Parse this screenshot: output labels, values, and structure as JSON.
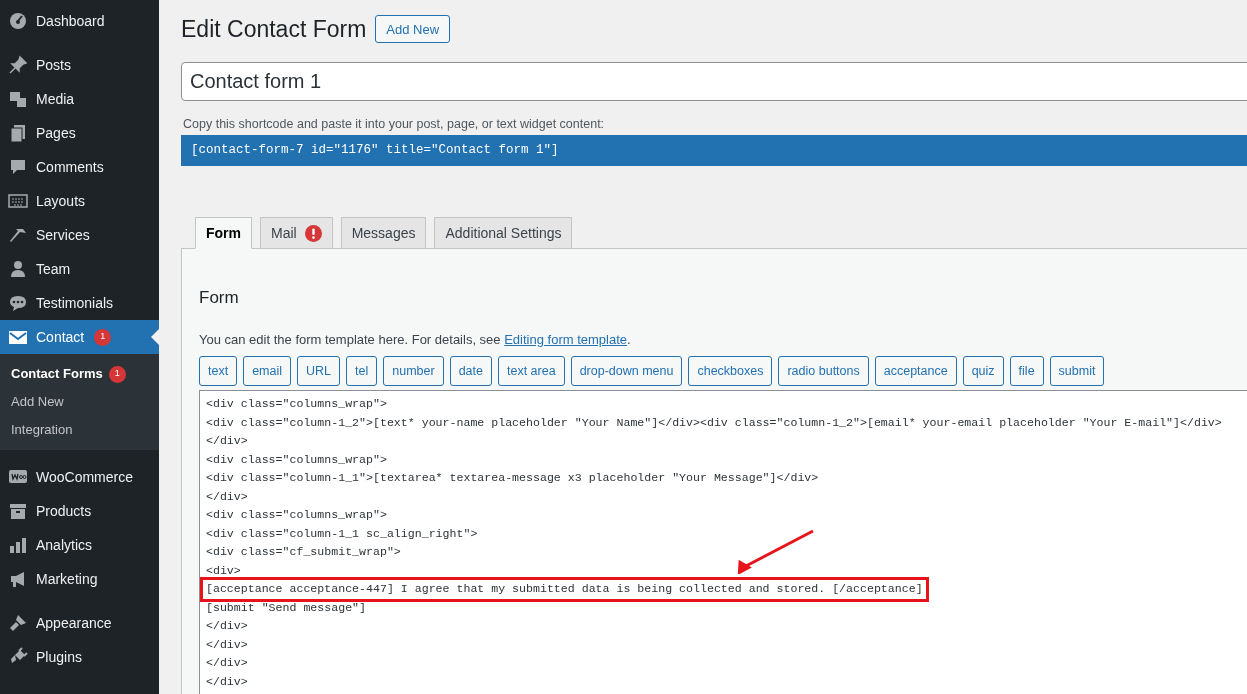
{
  "sidebar": {
    "groups": [
      {
        "items": [
          {
            "label": "Dashboard",
            "selected": false
          }
        ]
      },
      {
        "items": [
          {
            "label": "Posts",
            "selected": false
          },
          {
            "label": "Media",
            "selected": false
          },
          {
            "label": "Pages",
            "selected": false
          },
          {
            "label": "Comments",
            "selected": false
          },
          {
            "label": "Layouts",
            "selected": false
          },
          {
            "label": "Services",
            "selected": false
          },
          {
            "label": "Team",
            "selected": false
          },
          {
            "label": "Testimonials",
            "selected": false
          },
          {
            "label": "Contact",
            "selected": true,
            "badge": "1",
            "submenu": [
              {
                "label": "Contact Forms",
                "selected": true,
                "badge": "1"
              },
              {
                "label": "Add New",
                "selected": false
              },
              {
                "label": "Integration",
                "selected": false
              }
            ]
          }
        ]
      },
      {
        "items": [
          {
            "label": "WooCommerce",
            "selected": false
          },
          {
            "label": "Products",
            "selected": false
          },
          {
            "label": "Analytics",
            "selected": false
          },
          {
            "label": "Marketing",
            "selected": false
          }
        ]
      },
      {
        "items": [
          {
            "label": "Appearance",
            "selected": false
          },
          {
            "label": "Plugins",
            "selected": false
          }
        ]
      }
    ]
  },
  "page": {
    "title": "Edit Contact Form",
    "add_new": "Add New",
    "form_title": "Contact form 1",
    "shortcode_hint": "Copy this shortcode and paste it into your post, page, or text widget content:",
    "shortcode": "[contact-form-7 id=\"1176\" title=\"Contact form 1\"]"
  },
  "tabs": [
    {
      "label": "Form",
      "selected": true,
      "alert": false
    },
    {
      "label": "Mail",
      "selected": false,
      "alert": true
    },
    {
      "label": "Messages",
      "selected": false,
      "alert": false
    },
    {
      "label": "Additional Settings",
      "selected": false,
      "alert": false
    }
  ],
  "panel": {
    "heading": "Form",
    "description": "You can edit the form template here. For details, see ",
    "link": "Editing form template",
    "description_end": ".",
    "tag_buttons": [
      "text",
      "email",
      "URL",
      "tel",
      "number",
      "date",
      "text area",
      "drop-down menu",
      "checkboxes",
      "radio buttons",
      "acceptance",
      "quiz",
      "file",
      "submit"
    ],
    "code_lines": [
      {
        "text": "<div class=\"columns_wrap\">",
        "highlighted": false
      },
      {
        "text": "<div class=\"column-1_2\">[text* your-name placeholder \"Your Name\"]</div><div class=\"column-1_2\">[email* your-email placeholder \"Your E-mail\"]</div>",
        "highlighted": false
      },
      {
        "text": "</div>",
        "highlighted": false
      },
      {
        "text": "<div class=\"columns_wrap\">",
        "highlighted": false
      },
      {
        "text": "<div class=\"column-1_1\">[textarea* textarea-message x3 placeholder \"Your Message\"]</div>",
        "highlighted": false
      },
      {
        "text": "</div>",
        "highlighted": false
      },
      {
        "text": "<div class=\"columns_wrap\">",
        "highlighted": false
      },
      {
        "text": "<div class=\"column-1_1 sc_align_right\">",
        "highlighted": false
      },
      {
        "text": "<div class=\"cf_submit_wrap\">",
        "highlighted": false
      },
      {
        "text": "<div>",
        "highlighted": false
      },
      {
        "text": "[acceptance acceptance-447] I agree that my submitted data is being collected and stored. [/acceptance]",
        "highlighted": true
      },
      {
        "text": "[submit \"Send message\"]",
        "highlighted": false
      },
      {
        "text": "</div>",
        "highlighted": false
      },
      {
        "text": "</div>",
        "highlighted": false
      },
      {
        "text": "</div>",
        "highlighted": false
      },
      {
        "text": "</div>",
        "highlighted": false
      }
    ]
  }
}
